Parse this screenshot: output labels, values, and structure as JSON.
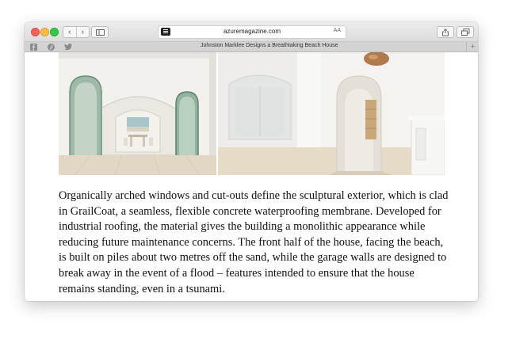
{
  "browser": {
    "url": "azuremagazine.com",
    "reader_aa": "AA",
    "back_glyph": "‹",
    "forward_glyph": "›",
    "tab_title": "Johnston Marklee Designs a Breathtaking Beach House",
    "new_tab_glyph": "+",
    "favorites": [
      "facebook-icon",
      "pinterest-icon",
      "twitter-icon"
    ]
  },
  "article": {
    "paragraph": "Organically arched windows and cut-outs define the sculptural exterior, which is clad in GrailCoat, a seamless, flexible concrete waterproofing membrane. Developed for industrial roofing, the material gives the building a monolithic appearance while reducing future maintenance concerns. The front half of the house, facing the beach, is built on piles about two metres off the sand, while the garage walls are designed to break away in the event of a flood – features intended to ensure that the house remains standing, even in a tsunami.",
    "images": [
      "arched-interior-photo",
      "arched-corridor-photo"
    ]
  },
  "colors": {
    "close": "#fc605c",
    "minimize": "#fdbc40",
    "zoom": "#34c84a",
    "toolbar": "#dcdcdc",
    "text": "#111111"
  }
}
